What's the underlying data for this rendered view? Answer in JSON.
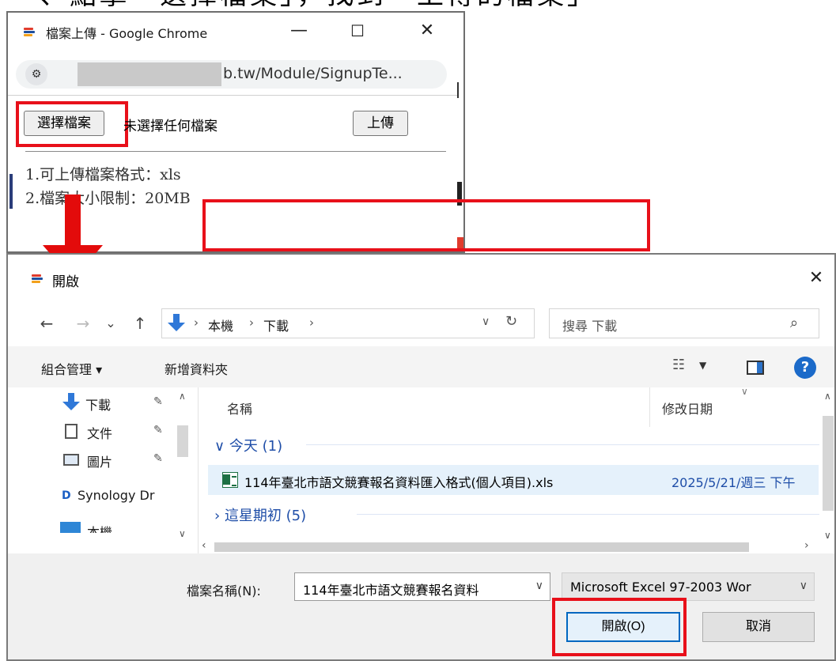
{
  "caption": {
    "text": "一、點擊「選擇檔案」，找到「上傳的檔案」"
  },
  "chrome": {
    "title": "檔案上傳 - Google Chrome",
    "min": "—",
    "max": "☐",
    "close": "✕",
    "site_info": "⚙",
    "url": "b.tw/Module/SignupTe..."
  },
  "form": {
    "choose_label": "選擇檔案",
    "no_file": "未選擇任何檔案",
    "upload_label": "上傳",
    "notes": [
      "1.可上傳檔案格式：xls",
      "2.檔案大小限制：20MB"
    ]
  },
  "dialog": {
    "title": "開啟",
    "close": "✕",
    "nav": {
      "back": "←",
      "forward": "→",
      "recent": "⌄",
      "up": "↑"
    },
    "breadcrumb": [
      "本機",
      "下載"
    ],
    "search_placeholder": "搜尋 下載",
    "toolbar": {
      "organize": "組合管理 ▾",
      "new_folder": "新增資料夾",
      "help": "?"
    },
    "sidebar": [
      {
        "label": "下載",
        "icon": "download-icon",
        "pinned": true
      },
      {
        "label": "文件",
        "icon": "document-icon",
        "pinned": true
      },
      {
        "label": "圖片",
        "icon": "picture-icon",
        "pinned": true
      },
      {
        "label": "Synology Dr",
        "icon": "synology-icon",
        "pinned": false
      },
      {
        "label": "本機",
        "icon": "computer-icon",
        "pinned": false
      }
    ],
    "columns": {
      "name": "名稱",
      "modified": "修改日期"
    },
    "groups": [
      {
        "label": "今天 (1)",
        "expanded": true
      },
      {
        "label": "這星期初 (5)",
        "expanded": false
      }
    ],
    "file": {
      "name": "114年臺北市語文競賽報名資料匯入格式(個人項目).xls",
      "date": "2025/5/21/週三 下午"
    },
    "filename_label": "檔案名稱(N):",
    "filename_value": "114年臺北市語文競賽報名資料",
    "filetype_value": "Microsoft Excel 97-2003 Wor",
    "open_label": "開啟(O)",
    "cancel_label": "取消"
  },
  "colors": {
    "highlight": "#e8101a",
    "arrow": "#e30b0b",
    "accent": "#0067c0"
  }
}
